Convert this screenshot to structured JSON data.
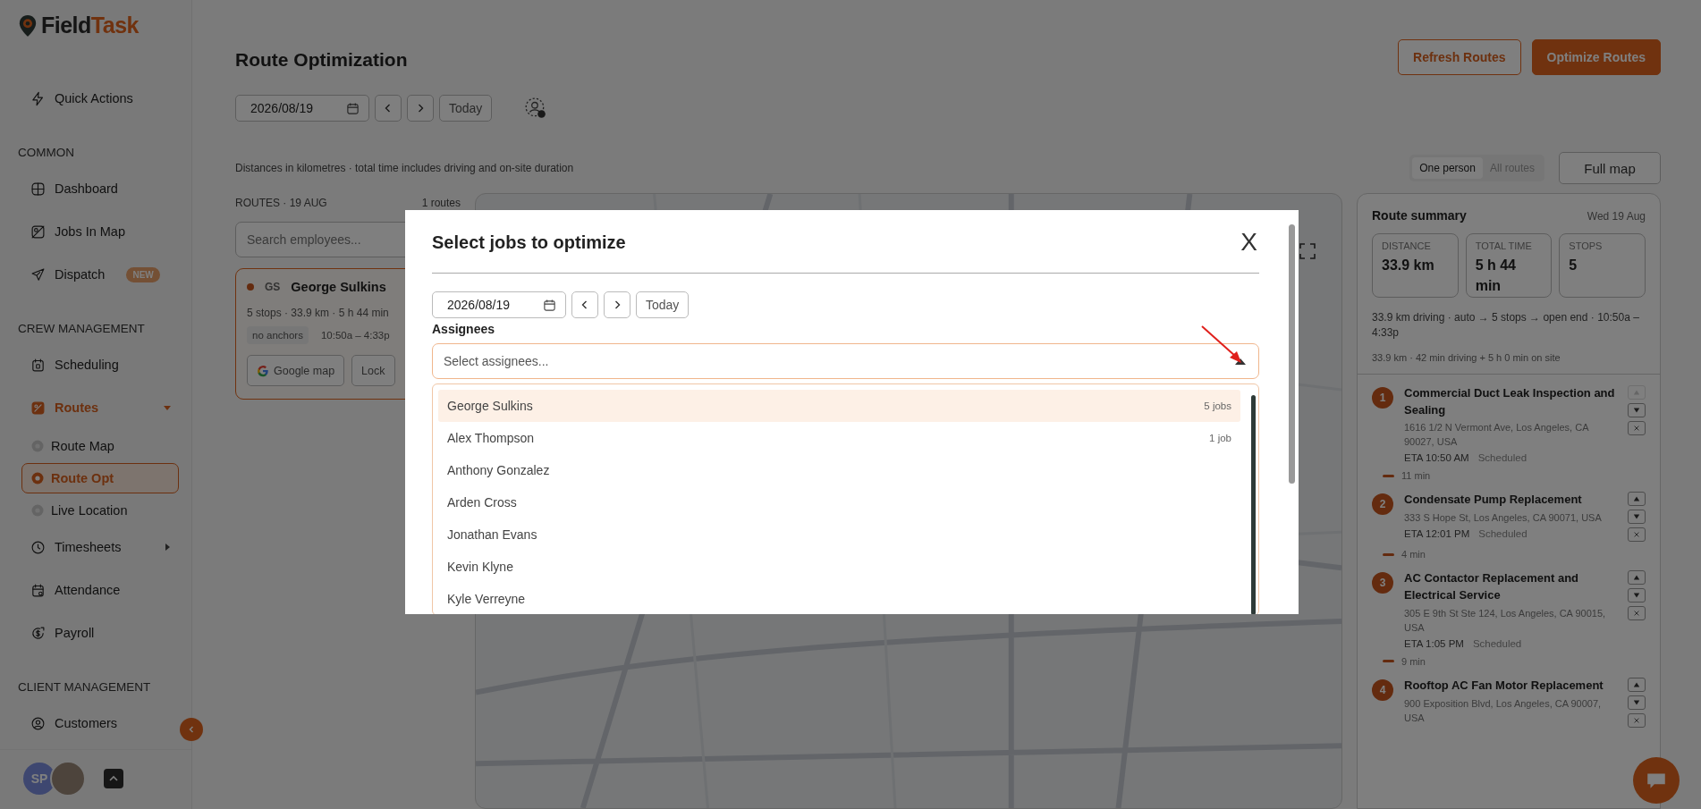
{
  "sidebar": {
    "brand": {
      "name_part_1": "Field",
      "name_part_2": "Task"
    },
    "sections": [
      {
        "items": [
          {
            "label": "Quick Actions",
            "kind": "link",
            "selected": false
          }
        ]
      },
      {
        "heading": "COMMON",
        "items": [
          {
            "label": "Dashboard",
            "kind": "link",
            "selected": false
          },
          {
            "label": "Jobs In Map",
            "kind": "link",
            "selected": false
          },
          {
            "label": "Dispatch",
            "kind": "link",
            "selected": false,
            "badge": "NEW"
          }
        ]
      },
      {
        "heading": "CREW MANAGEMENT",
        "items": [
          {
            "label": "Scheduling",
            "kind": "link",
            "selected": false
          },
          {
            "label": "Routes",
            "kind": "group",
            "selected": true,
            "expanded": true,
            "children": [
              {
                "label": "Route Map",
                "selected": false
              },
              {
                "label": "Route Opt",
                "selected": true
              },
              {
                "label": "Live Location",
                "selected": false
              }
            ]
          },
          {
            "label": "Timesheets",
            "kind": "group",
            "selected": false,
            "expanded": false
          },
          {
            "label": "Attendance",
            "kind": "link",
            "selected": false
          },
          {
            "label": "Payroll",
            "kind": "link",
            "selected": false
          }
        ]
      },
      {
        "heading": "CLIENT MANAGEMENT",
        "items": [
          {
            "label": "Customers",
            "kind": "link",
            "selected": false
          }
        ]
      }
    ],
    "user": {
      "initials": "SP"
    }
  },
  "header": {
    "title": "Route Optimization",
    "buttons": [
      {
        "label": "Refresh Routes",
        "kind": "secondary"
      },
      {
        "label": "Optimize Routes",
        "kind": "primary"
      }
    ]
  },
  "toolbar": {
    "date": "2026/08/19",
    "today": "Today"
  },
  "note": "Distances in kilometres · total time includes driving and on-site duration",
  "view_toggle": [
    {
      "label": "One person",
      "selected": true
    },
    {
      "label": "All routes",
      "selected": false
    }
  ],
  "full_map": "Full map",
  "routes_panel": {
    "heading": "ROUTES · 19 AUG",
    "count": "1 routes",
    "search_placeholder": "Search employees...",
    "card": {
      "initials": "GS",
      "name": "George Sulkins",
      "stats": "5 stops · 33.9 km · 5 h 44 min",
      "tags": [
        "no anchors",
        "10:50a – 4:33p"
      ],
      "buttons": [
        "Google map",
        "Lock"
      ]
    }
  },
  "summary": {
    "title": "Route summary",
    "date": "Wed 19 Aug",
    "stats": [
      {
        "label": "DISTANCE",
        "value": "33.9 km"
      },
      {
        "label": "TOTAL TIME",
        "value": "5 h 44 min"
      },
      {
        "label": "STOPS",
        "value": "5"
      }
    ],
    "line": "33.9 km driving · auto → 5 stops → open end · 10:50a – 4:33p",
    "subline": "33.9 km · 42 min driving + 5 h 0 min on site",
    "stops": [
      {
        "number": "1",
        "title": "Commercial Duct Leak Inspection and Sealing",
        "address": "1616 1/2 N Vermont Ave, Los Angeles, CA 90027, USA",
        "eta": "ETA 10:50 AM",
        "status": "Scheduled",
        "can_move_up": false,
        "travel": "11 min"
      },
      {
        "number": "2",
        "title": "Condensate Pump Replacement",
        "address": "333 S Hope St, Los Angeles, CA 90071, USA",
        "eta": "ETA 12:01 PM",
        "status": "Scheduled",
        "can_move_up": true,
        "travel": "4 min"
      },
      {
        "number": "3",
        "title": "AC Contactor Replacement and Electrical Service",
        "address": "305 E 9th St Ste 124, Los Angeles, CA 90015, USA",
        "eta": "ETA 1:05 PM",
        "status": "Scheduled",
        "can_move_up": true,
        "travel": "9 min"
      },
      {
        "number": "4",
        "title": "Rooftop AC Fan Motor Replacement",
        "address": "900 Exposition Blvd, Los Angeles, CA 90007, USA",
        "can_move_up": true
      }
    ]
  },
  "modal": {
    "title": "Select jobs to optimize",
    "close": "X",
    "date": "2026/08/19",
    "today": "Today",
    "assignees_label": "Assignees",
    "assignees_placeholder": "Select assignees...",
    "options": [
      {
        "name": "George Sulkins",
        "count": "5 jobs",
        "selected": true
      },
      {
        "name": "Alex Thompson",
        "count": "1 job",
        "selected": false
      },
      {
        "name": "Anthony Gonzalez",
        "selected": false
      },
      {
        "name": "Arden Cross",
        "selected": false
      },
      {
        "name": "Jonathan Evans",
        "selected": false
      },
      {
        "name": "Kevin Klyne",
        "selected": false
      },
      {
        "name": "Kyle Verreyne",
        "selected": false
      }
    ]
  }
}
